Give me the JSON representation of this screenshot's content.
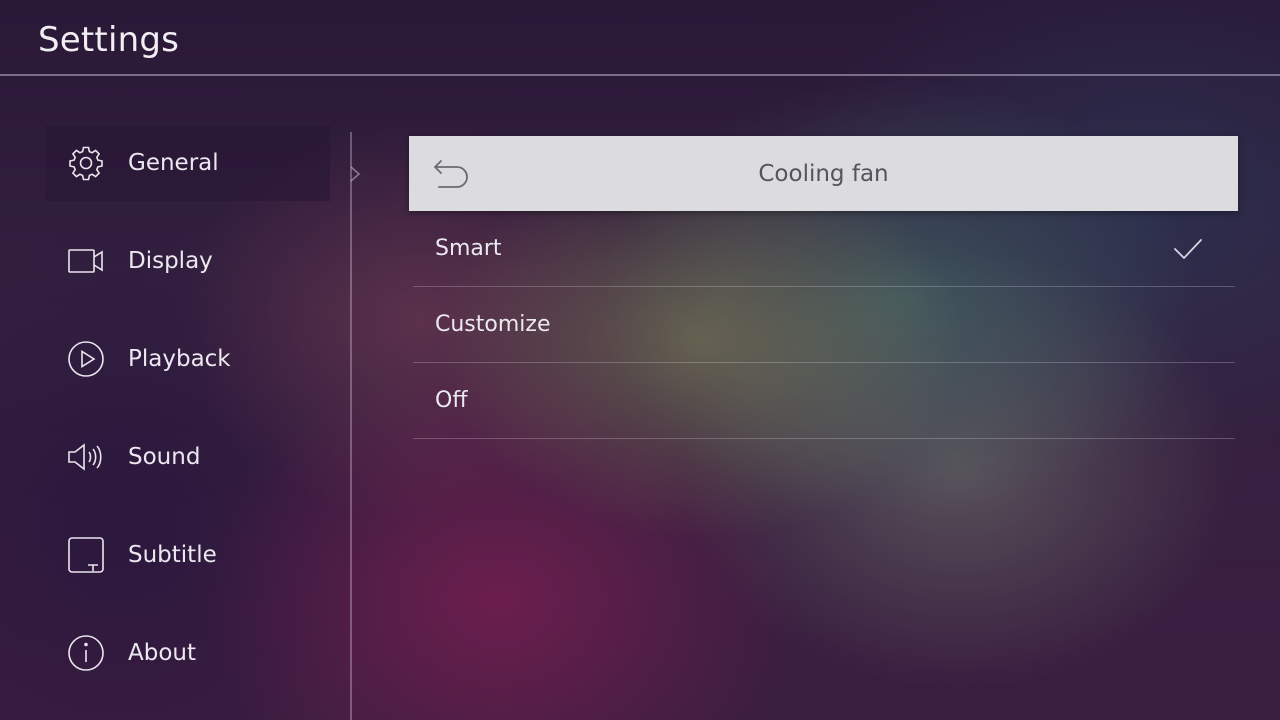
{
  "app": {
    "title": "Settings"
  },
  "sidebar": {
    "items": [
      {
        "label": "General",
        "icon": "gear-icon",
        "active": true
      },
      {
        "label": "Display",
        "icon": "display-icon",
        "active": false
      },
      {
        "label": "Playback",
        "icon": "play-icon",
        "active": false
      },
      {
        "label": "Sound",
        "icon": "speaker-icon",
        "active": false
      },
      {
        "label": "Subtitle",
        "icon": "subtitle-icon",
        "active": false
      },
      {
        "label": "About",
        "icon": "info-icon",
        "active": false
      }
    ]
  },
  "panel": {
    "title": "Cooling fan",
    "back_icon": "back-arrow-icon",
    "options": [
      {
        "label": "Smart",
        "selected": true
      },
      {
        "label": "Customize",
        "selected": false
      },
      {
        "label": "Off",
        "selected": false
      }
    ],
    "selected_icon": "checkmark-icon"
  },
  "colors": {
    "header_bg": "#dcdce0",
    "header_text": "#55545a",
    "text": "#ece8f0"
  }
}
